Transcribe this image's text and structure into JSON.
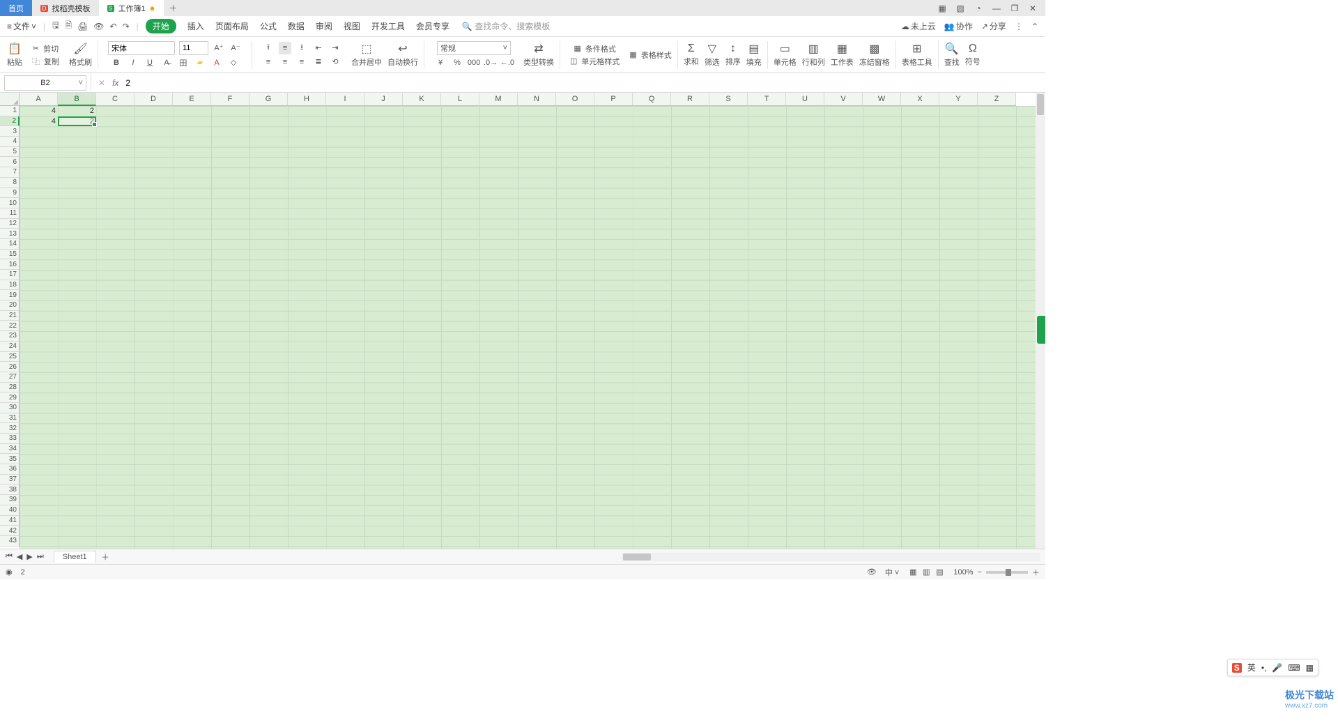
{
  "titlebar": {
    "tabs": [
      {
        "label": "首页",
        "type": "home"
      },
      {
        "label": "找稻壳模板",
        "type": "app"
      },
      {
        "label": "工作簿1",
        "type": "doc",
        "modified": true
      }
    ]
  },
  "window_controls": {
    "grid1": "▦",
    "grid2": "▧",
    "user": "◔",
    "min": "—",
    "max": "❐",
    "close": "✕"
  },
  "menubar": {
    "file": "文件",
    "tabs": [
      "开始",
      "插入",
      "页面布局",
      "公式",
      "数据",
      "审阅",
      "视图",
      "开发工具",
      "会员专享"
    ],
    "active_tab": "开始",
    "search_placeholder": "查找命令、搜索模板",
    "search_icon_hint": "查找命令",
    "right": {
      "cloud": "未上云",
      "collab": "协作",
      "share": "分享"
    }
  },
  "ribbon": {
    "paste": "粘贴",
    "cut": "剪切",
    "copy": "复制",
    "format_painter": "格式刷",
    "font_name": "宋体",
    "font_size": "11",
    "btns": {
      "bold": "B",
      "italic": "I",
      "underline": "U",
      "strike": "S",
      "border": "田",
      "fill": "▰",
      "fontcolor": "A",
      "clear": "◇"
    },
    "align": "合并居中",
    "wrap": "自动换行",
    "number_format": "常规",
    "type_convert": "类型转换",
    "cond_fmt": "条件格式",
    "cell_style": "单元格样式",
    "table_style": "表格样式",
    "sum": "求和",
    "filter": "筛选",
    "sort": "排序",
    "fill_series": "填充",
    "cells": "单元格",
    "rows_cols": "行和列",
    "worksheet": "工作表",
    "freeze": "冻结窗格",
    "table_tools": "表格工具",
    "find": "查找",
    "symbol": "符号"
  },
  "formula_bar": {
    "name_box": "B2",
    "fx": "fx",
    "value": "2"
  },
  "grid": {
    "columns": [
      "A",
      "B",
      "C",
      "D",
      "E",
      "F",
      "G",
      "H",
      "I",
      "J",
      "K",
      "L",
      "M",
      "N",
      "O",
      "P",
      "Q",
      "R",
      "S",
      "T",
      "U",
      "V",
      "W",
      "X",
      "Y",
      "Z"
    ],
    "row_count": 43,
    "selected_col": "B",
    "selected_row": 2,
    "cells": {
      "A1": "4",
      "B1": "2",
      "A2": "4",
      "B2": "2"
    }
  },
  "sheetbar": {
    "sheet": "Sheet1"
  },
  "statusbar": {
    "value": "2",
    "zoom": "100%"
  },
  "ime": {
    "s": "S",
    "lang": "英",
    "punct": "•,",
    "mic": "🎤",
    "kbd": "⌨",
    "grid": "▦"
  },
  "watermark": {
    "brand": "极光下载站",
    "url": "www.xz7.com"
  }
}
